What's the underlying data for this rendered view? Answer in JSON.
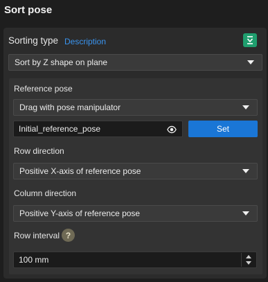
{
  "panel": {
    "title": "Sort pose"
  },
  "sorting": {
    "label": "Sorting type",
    "description_link": "Description",
    "icon": "generate-icon",
    "selected": "Sort by Z shape on plane"
  },
  "reference_pose": {
    "label": "Reference pose",
    "method_selected": "Drag with pose manipulator",
    "name_value": "Initial_reference_pose",
    "visibility_icon": "eye-icon",
    "set_label": "Set"
  },
  "row_direction": {
    "label": "Row direction",
    "selected": "Positive X-axis of reference pose"
  },
  "column_direction": {
    "label": "Column direction",
    "selected": "Positive Y-axis of reference pose"
  },
  "row_interval": {
    "label": "Row interval",
    "help_glyph": "?",
    "value": "100 mm"
  },
  "colors": {
    "accent": "#1a76d6",
    "link": "#3a95f0",
    "icon_green": "#1f9e6e"
  }
}
